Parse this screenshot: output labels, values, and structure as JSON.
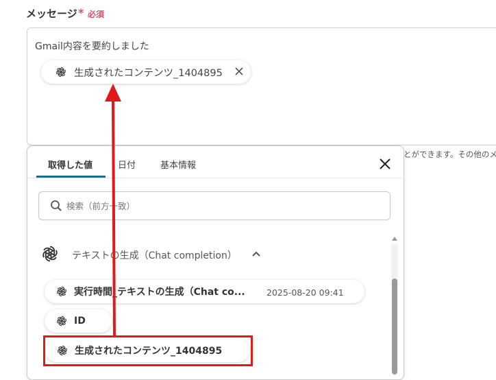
{
  "field": {
    "label": "メッセージ",
    "required_star": "*",
    "required_text": "必須"
  },
  "message": {
    "text": "Gmail内容を要約しました",
    "chip_label": "生成されたコンテンツ_1404895"
  },
  "hint_text": "とができます。その他のメ",
  "panel": {
    "tabs": [
      {
        "label": "取得した値",
        "active": true
      },
      {
        "label": "日付",
        "active": false
      },
      {
        "label": "基本情報",
        "active": false
      }
    ],
    "search_placeholder": "検索（前方一致）",
    "group": {
      "label": "テキストの生成（Chat completion）",
      "icon": "openai-icon",
      "expanded": true
    },
    "items": [
      {
        "label": "実行時間_テキストの生成（Chat co...",
        "time": "2025-08-20 09:41",
        "icon": "openai-icon"
      },
      {
        "label": "ID",
        "icon": "openai-icon"
      },
      {
        "label": "生成されたコンテンツ_1404895",
        "icon": "openai-icon",
        "highlighted": true
      }
    ]
  },
  "colors": {
    "accent_tab": "#1a6e86",
    "required": "#e04e6b",
    "annotation_red": "#e0191b"
  }
}
